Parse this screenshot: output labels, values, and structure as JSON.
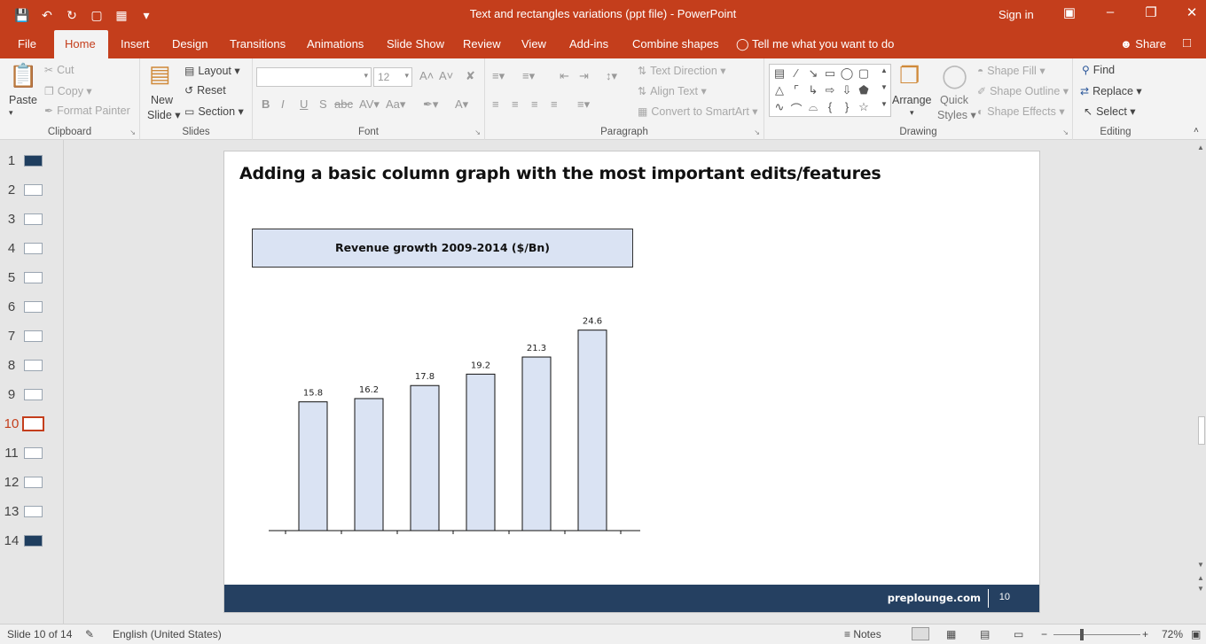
{
  "window": {
    "title": "Text and rectangles variations (ppt file)  -  PowerPoint",
    "sign_in": "Sign in"
  },
  "tabs": [
    "File",
    "Home",
    "Insert",
    "Design",
    "Transitions",
    "Animations",
    "Slide Show",
    "Review",
    "View",
    "Add-ins",
    "Combine shapes"
  ],
  "tell_me": "Tell me what you want to do",
  "share": "Share",
  "ribbon": {
    "clipboard": {
      "label": "Clipboard",
      "paste": "Paste",
      "cut": "Cut",
      "copy": "Copy",
      "format_painter": "Format Painter"
    },
    "slides": {
      "label": "Slides",
      "new_slide_1": "New",
      "new_slide_2": "Slide",
      "layout": "Layout",
      "reset": "Reset",
      "section": "Section"
    },
    "font": {
      "label": "Font",
      "family": "",
      "size": "12"
    },
    "paragraph": {
      "label": "Paragraph",
      "text_direction": "Text Direction",
      "align_text": "Align Text",
      "convert_smartart": "Convert to SmartArt"
    },
    "drawing": {
      "label": "Drawing",
      "arrange": "Arrange",
      "quick_styles_1": "Quick",
      "quick_styles_2": "Styles",
      "shape_fill": "Shape Fill",
      "shape_outline": "Shape Outline",
      "shape_effects": "Shape Effects"
    },
    "editing": {
      "label": "Editing",
      "find": "Find",
      "replace": "Replace",
      "select": "Select"
    }
  },
  "thumbnails": {
    "numbers": [
      "1",
      "2",
      "3",
      "4",
      "5",
      "6",
      "7",
      "8",
      "9",
      "10",
      "11",
      "12",
      "13",
      "14"
    ],
    "selected": 10
  },
  "slide": {
    "title": "Adding a basic column graph with the most important edits/features",
    "footer_brand": "preplounge.com",
    "page_number": "10"
  },
  "chart_data": {
    "type": "bar",
    "title": "Revenue growth 2009-2014 ($/Bn)",
    "categories": [
      "",
      "",
      "",
      "",
      "",
      ""
    ],
    "values": [
      15.8,
      16.2,
      17.8,
      19.2,
      21.3,
      24.6
    ],
    "data_labels": [
      "15.8",
      "16.2",
      "17.8",
      "19.2",
      "21.3",
      "24.6"
    ],
    "ylim": [
      0,
      25
    ],
    "bar_color": "#dae3f3",
    "grid": false
  },
  "status": {
    "slide_info": "Slide 10 of 14",
    "language": "English (United States)",
    "notes": "Notes",
    "zoom": "72%"
  },
  "colors": {
    "accent": "#c43e1c",
    "footer": "#254061"
  }
}
